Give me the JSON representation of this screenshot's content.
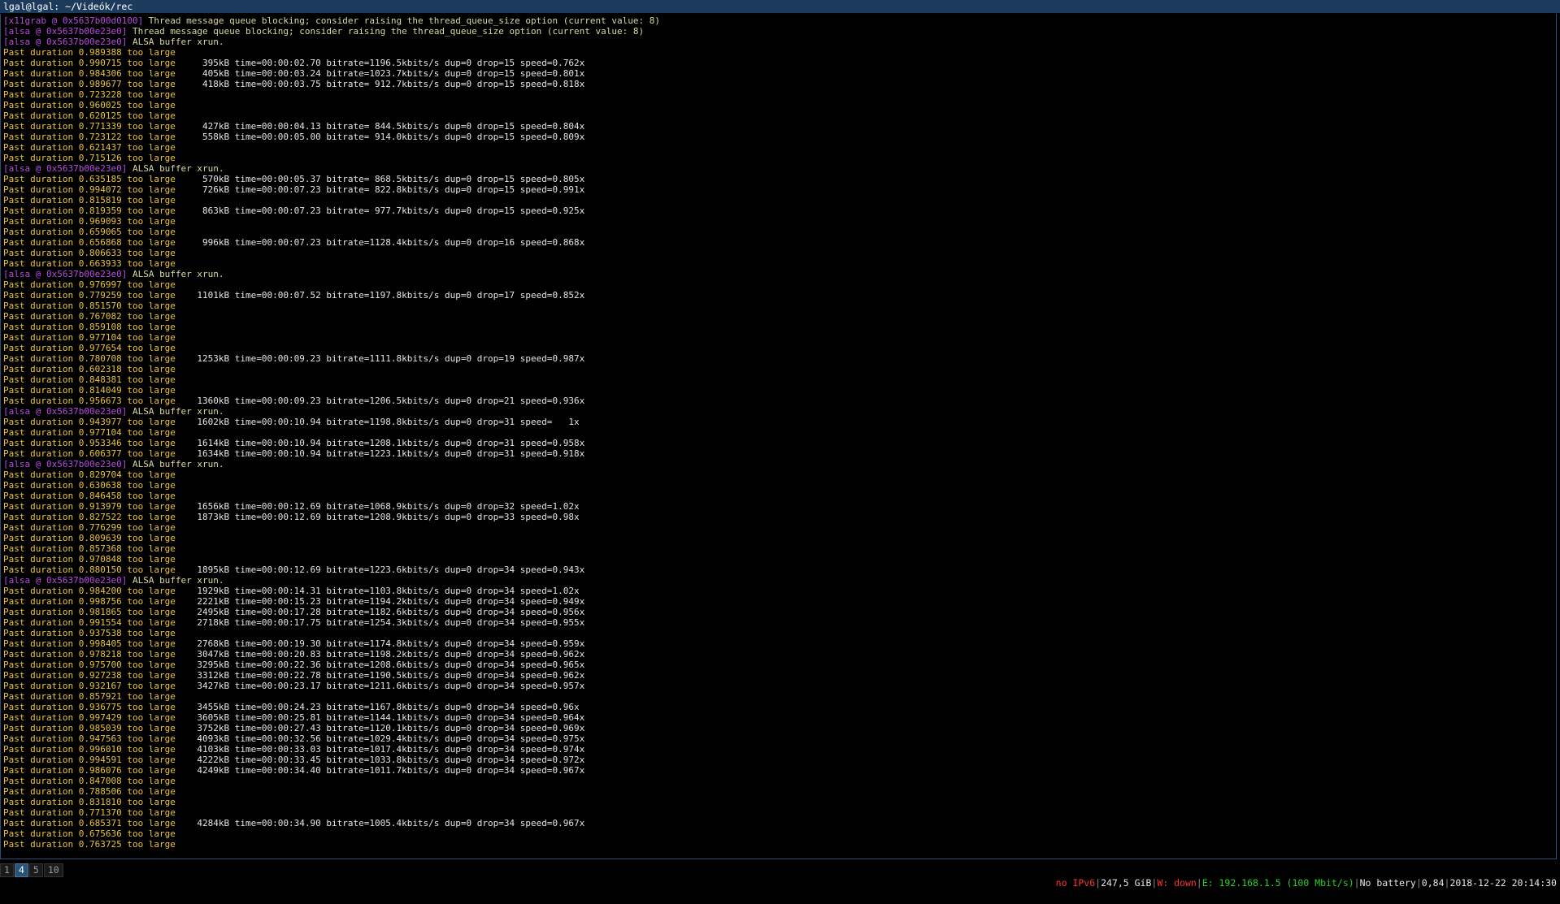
{
  "window": {
    "title": "lgal@lgal: ~/Videók/rec"
  },
  "terminal": {
    "lines": [
      {
        "tag": "[x11grab @ 0x5637b00d0100]",
        "text": " Thread message queue blocking; consider raising the thread_queue_size option (current value: 8)"
      },
      {
        "tag": "[alsa @ 0x5637b00e23e0]",
        "text": " Thread message queue blocking; consider raising the thread_queue_size option (current value: 8)"
      },
      {
        "tag": "[alsa @ 0x5637b00e23e0]",
        "text": " ALSA buffer xrun."
      },
      {
        "text": "Past duration 0.989388 too large"
      },
      {
        "text": "Past duration 0.990715 too large",
        "stat": "     395kB time=00:00:02.70 bitrate=1196.5kbits/s dup=0 drop=15 speed=0.762x"
      },
      {
        "text": "Past duration 0.984306 too large",
        "stat": "     405kB time=00:00:03.24 bitrate=1023.7kbits/s dup=0 drop=15 speed=0.801x"
      },
      {
        "text": "Past duration 0.989677 too large",
        "stat": "     418kB time=00:00:03.75 bitrate= 912.7kbits/s dup=0 drop=15 speed=0.818x"
      },
      {
        "text": "Past duration 0.723228 too large"
      },
      {
        "text": "Past duration 0.960025 too large"
      },
      {
        "text": "Past duration 0.620125 too large"
      },
      {
        "text": "Past duration 0.771339 too large",
        "stat": "     427kB time=00:00:04.13 bitrate= 844.5kbits/s dup=0 drop=15 speed=0.804x"
      },
      {
        "text": "Past duration 0.723122 too large",
        "stat": "     558kB time=00:00:05.00 bitrate= 914.0kbits/s dup=0 drop=15 speed=0.809x"
      },
      {
        "text": "Past duration 0.621437 too large"
      },
      {
        "text": "Past duration 0.715126 too large"
      },
      {
        "tag": "[alsa @ 0x5637b00e23e0]",
        "text": " ALSA buffer xrun."
      },
      {
        "text": "Past duration 0.635185 too large",
        "stat": "     570kB time=00:00:05.37 bitrate= 868.5kbits/s dup=0 drop=15 speed=0.805x"
      },
      {
        "text": "Past duration 0.994072 too large",
        "stat": "     726kB time=00:00:07.23 bitrate= 822.8kbits/s dup=0 drop=15 speed=0.991x"
      },
      {
        "text": "Past duration 0.815819 too large"
      },
      {
        "text": "Past duration 0.819359 too large",
        "stat": "     863kB time=00:00:07.23 bitrate= 977.7kbits/s dup=0 drop=15 speed=0.925x"
      },
      {
        "text": "Past duration 0.969093 too large"
      },
      {
        "text": "Past duration 0.659065 too large"
      },
      {
        "text": "Past duration 0.656868 too large",
        "stat": "     996kB time=00:00:07.23 bitrate=1128.4kbits/s dup=0 drop=16 speed=0.868x"
      },
      {
        "text": "Past duration 0.806633 too large"
      },
      {
        "text": "Past duration 0.663933 too large"
      },
      {
        "tag": "[alsa @ 0x5637b00e23e0]",
        "text": " ALSA buffer xrun."
      },
      {
        "text": "Past duration 0.976997 too large"
      },
      {
        "text": "Past duration 0.779259 too large",
        "stat": "    1101kB time=00:00:07.52 bitrate=1197.8kbits/s dup=0 drop=17 speed=0.852x"
      },
      {
        "text": "Past duration 0.851570 too large"
      },
      {
        "text": "Past duration 0.767082 too large"
      },
      {
        "text": "Past duration 0.859108 too large"
      },
      {
        "text": "Past duration 0.977104 too large"
      },
      {
        "text": "Past duration 0.977654 too large"
      },
      {
        "text": "Past duration 0.780708 too large",
        "stat": "    1253kB time=00:00:09.23 bitrate=1111.8kbits/s dup=0 drop=19 speed=0.987x"
      },
      {
        "text": "Past duration 0.602318 too large"
      },
      {
        "text": "Past duration 0.848381 too large"
      },
      {
        "text": "Past duration 0.814049 too large"
      },
      {
        "text": "Past duration 0.956673 too large",
        "stat": "    1360kB time=00:00:09.23 bitrate=1206.5kbits/s dup=0 drop=21 speed=0.936x"
      },
      {
        "tag": "[alsa @ 0x5637b00e23e0]",
        "text": " ALSA buffer xrun."
      },
      {
        "text": "Past duration 0.943977 too large",
        "stat": "    1602kB time=00:00:10.94 bitrate=1198.8kbits/s dup=0 drop=31 speed=   1x"
      },
      {
        "text": "Past duration 0.977104 too large"
      },
      {
        "text": "Past duration 0.953346 too large",
        "stat": "    1614kB time=00:00:10.94 bitrate=1208.1kbits/s dup=0 drop=31 speed=0.958x"
      },
      {
        "text": "Past duration 0.606377 too large",
        "stat": "    1634kB time=00:00:10.94 bitrate=1223.1kbits/s dup=0 drop=31 speed=0.918x"
      },
      {
        "tag": "[alsa @ 0x5637b00e23e0]",
        "text": " ALSA buffer xrun."
      },
      {
        "text": "Past duration 0.829704 too large"
      },
      {
        "text": "Past duration 0.630638 too large"
      },
      {
        "text": "Past duration 0.846458 too large"
      },
      {
        "text": "Past duration 0.913979 too large",
        "stat": "    1656kB time=00:00:12.69 bitrate=1068.9kbits/s dup=0 drop=32 speed=1.02x"
      },
      {
        "text": "Past duration 0.827522 too large",
        "stat": "    1873kB time=00:00:12.69 bitrate=1208.9kbits/s dup=0 drop=33 speed=0.98x"
      },
      {
        "text": "Past duration 0.776299 too large"
      },
      {
        "text": "Past duration 0.809639 too large"
      },
      {
        "text": "Past duration 0.857368 too large"
      },
      {
        "text": "Past duration 0.970848 too large"
      },
      {
        "text": "Past duration 0.880150 too large",
        "stat": "    1895kB time=00:00:12.69 bitrate=1223.6kbits/s dup=0 drop=34 speed=0.943x"
      },
      {
        "tag": "[alsa @ 0x5637b00e23e0]",
        "text": " ALSA buffer xrun."
      },
      {
        "text": "Past duration 0.984200 too large",
        "stat": "    1929kB time=00:00:14.31 bitrate=1103.8kbits/s dup=0 drop=34 speed=1.02x"
      },
      {
        "text": "Past duration 0.998756 too large",
        "stat": "    2221kB time=00:00:15.23 bitrate=1194.2kbits/s dup=0 drop=34 speed=0.949x"
      },
      {
        "text": "Past duration 0.981865 too large",
        "stat": "    2495kB time=00:00:17.28 bitrate=1182.6kbits/s dup=0 drop=34 speed=0.956x"
      },
      {
        "text": "Past duration 0.991554 too large",
        "stat": "    2718kB time=00:00:17.75 bitrate=1254.3kbits/s dup=0 drop=34 speed=0.955x"
      },
      {
        "text": "Past duration 0.937538 too large"
      },
      {
        "text": "Past duration 0.998405 too large",
        "stat": "    2768kB time=00:00:19.30 bitrate=1174.8kbits/s dup=0 drop=34 speed=0.959x"
      },
      {
        "text": "Past duration 0.978218 too large",
        "stat": "    3047kB time=00:00:20.83 bitrate=1198.2kbits/s dup=0 drop=34 speed=0.962x"
      },
      {
        "text": "Past duration 0.975700 too large",
        "stat": "    3295kB time=00:00:22.36 bitrate=1208.6kbits/s dup=0 drop=34 speed=0.965x"
      },
      {
        "text": "Past duration 0.927238 too large",
        "stat": "    3312kB time=00:00:22.78 bitrate=1190.5kbits/s dup=0 drop=34 speed=0.962x"
      },
      {
        "text": "Past duration 0.932167 too large",
        "stat": "    3427kB time=00:00:23.17 bitrate=1211.6kbits/s dup=0 drop=34 speed=0.957x"
      },
      {
        "text": "Past duration 0.857921 too large"
      },
      {
        "text": "Past duration 0.936775 too large",
        "stat": "    3455kB time=00:00:24.23 bitrate=1167.8kbits/s dup=0 drop=34 speed=0.96x"
      },
      {
        "text": "Past duration 0.997429 too large",
        "stat": "    3605kB time=00:00:25.81 bitrate=1144.1kbits/s dup=0 drop=34 speed=0.964x"
      },
      {
        "text": "Past duration 0.985039 too large",
        "stat": "    3752kB time=00:00:27.43 bitrate=1120.1kbits/s dup=0 drop=34 speed=0.969x"
      },
      {
        "text": "Past duration 0.947563 too large",
        "stat": "    4093kB time=00:00:32.56 bitrate=1029.4kbits/s dup=0 drop=34 speed=0.975x"
      },
      {
        "text": "Past duration 0.996010 too large",
        "stat": "    4103kB time=00:00:33.03 bitrate=1017.4kbits/s dup=0 drop=34 speed=0.974x"
      },
      {
        "text": "Past duration 0.994591 too large",
        "stat": "    4222kB time=00:00:33.45 bitrate=1033.8kbits/s dup=0 drop=34 speed=0.972x"
      },
      {
        "text": "Past duration 0.986076 too large",
        "stat": "    4249kB time=00:00:34.40 bitrate=1011.7kbits/s dup=0 drop=34 speed=0.967x"
      },
      {
        "text": "Past duration 0.847008 too large"
      },
      {
        "text": "Past duration 0.788506 too large"
      },
      {
        "text": "Past duration 0.831810 too large"
      },
      {
        "text": "Past duration 0.771370 too large"
      },
      {
        "text": "Past duration 0.685371 too large",
        "stat": "    4284kB time=00:00:34.90 bitrate=1005.4kbits/s dup=0 drop=34 speed=0.967x"
      },
      {
        "text": "Past duration 0.675636 too large"
      },
      {
        "text": "Past duration 0.763725 too large"
      }
    ]
  },
  "bar": {
    "workspaces": [
      {
        "label": "1",
        "active": false
      },
      {
        "label": "4",
        "active": true
      },
      {
        "label": "5",
        "active": false
      },
      {
        "label": "10",
        "active": false
      }
    ],
    "status": {
      "ipv6": "no IPv6",
      "disk": "247,5 GiB",
      "wifi": "W: down",
      "ethernet": "E: 192.168.1.5 (100 Mbit/s)",
      "battery": "No battery",
      "load": "0,84",
      "datetime": "2018-12-22 20:14:30"
    },
    "colors": {
      "bad": "#ff3333",
      "good": "#26d126",
      "active_ws": "#285577"
    }
  }
}
